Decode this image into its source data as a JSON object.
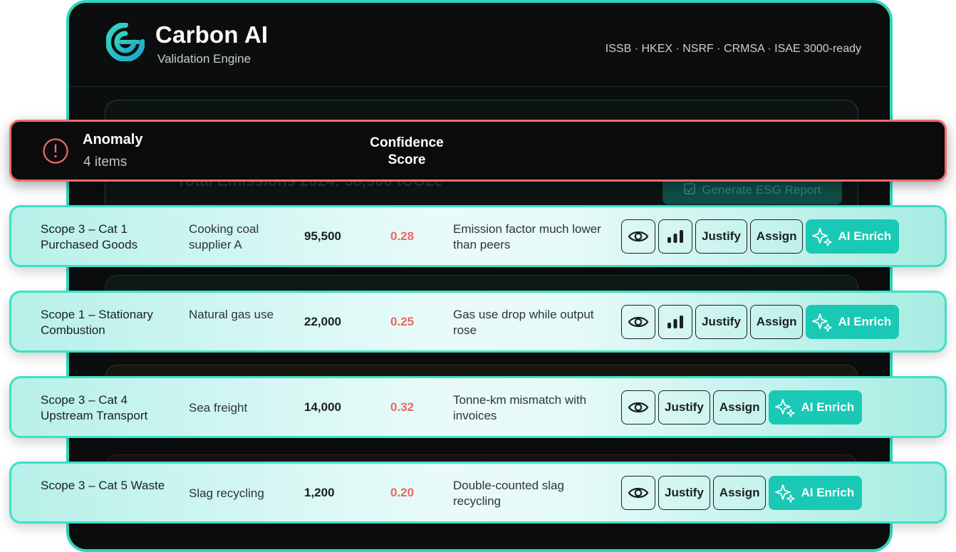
{
  "app": {
    "title": "Carbon AI",
    "subtitle": "Validation Engine",
    "standards": "ISSB · HKEX · NSRF · CRMSA · ISAE 3000-ready"
  },
  "background": {
    "total_emissions": "Total Emissions 2024: 38,900 tCO2e",
    "report_button": "Generate ESG Report"
  },
  "anomaly_panel": {
    "label": "Anomaly",
    "count": "4 items",
    "confidence_header": "Confidence Score"
  },
  "rows": [
    {
      "scope": "Scope 3 – Cat 1 Purchased Goods",
      "description": "Cooking coal supplier A",
      "value": "95,500",
      "score": "0.28",
      "reason": "Emission factor much lower than peers",
      "has_chart": true
    },
    {
      "scope": "Scope 1 – Stationary Combustion",
      "description": "Natural gas use",
      "value": "22,000",
      "score": "0.25",
      "reason": "Gas use drop while output rose",
      "has_chart": true
    },
    {
      "scope": "Scope 3 – Cat 4 Upstream Transport",
      "description": "Sea freight",
      "value": "14,000",
      "score": "0.32",
      "reason": "Tonne-km mismatch with invoices",
      "has_chart": false
    },
    {
      "scope": "Scope 3 – Cat 5 Waste",
      "description": "Slag recycling",
      "value": "1,200",
      "score": "0.20",
      "reason": "Double-counted slag recycling",
      "has_chart": false
    }
  ],
  "actions": {
    "justify": "Justify",
    "assign": "Assign",
    "ai_enrich": "AI Enrich"
  },
  "icons": {
    "view": "eye-icon",
    "chart": "bar-chart-icon",
    "ai": "sparkle-icon",
    "alert": "alert-circle-icon",
    "logo": "carbon-ai-logo"
  },
  "colors": {
    "accent": "#2fd6bd",
    "ai_button": "#19c9b5",
    "alert": "#ee6b6b",
    "score": "#ef6666",
    "app_bg": "#0c0d0e"
  }
}
